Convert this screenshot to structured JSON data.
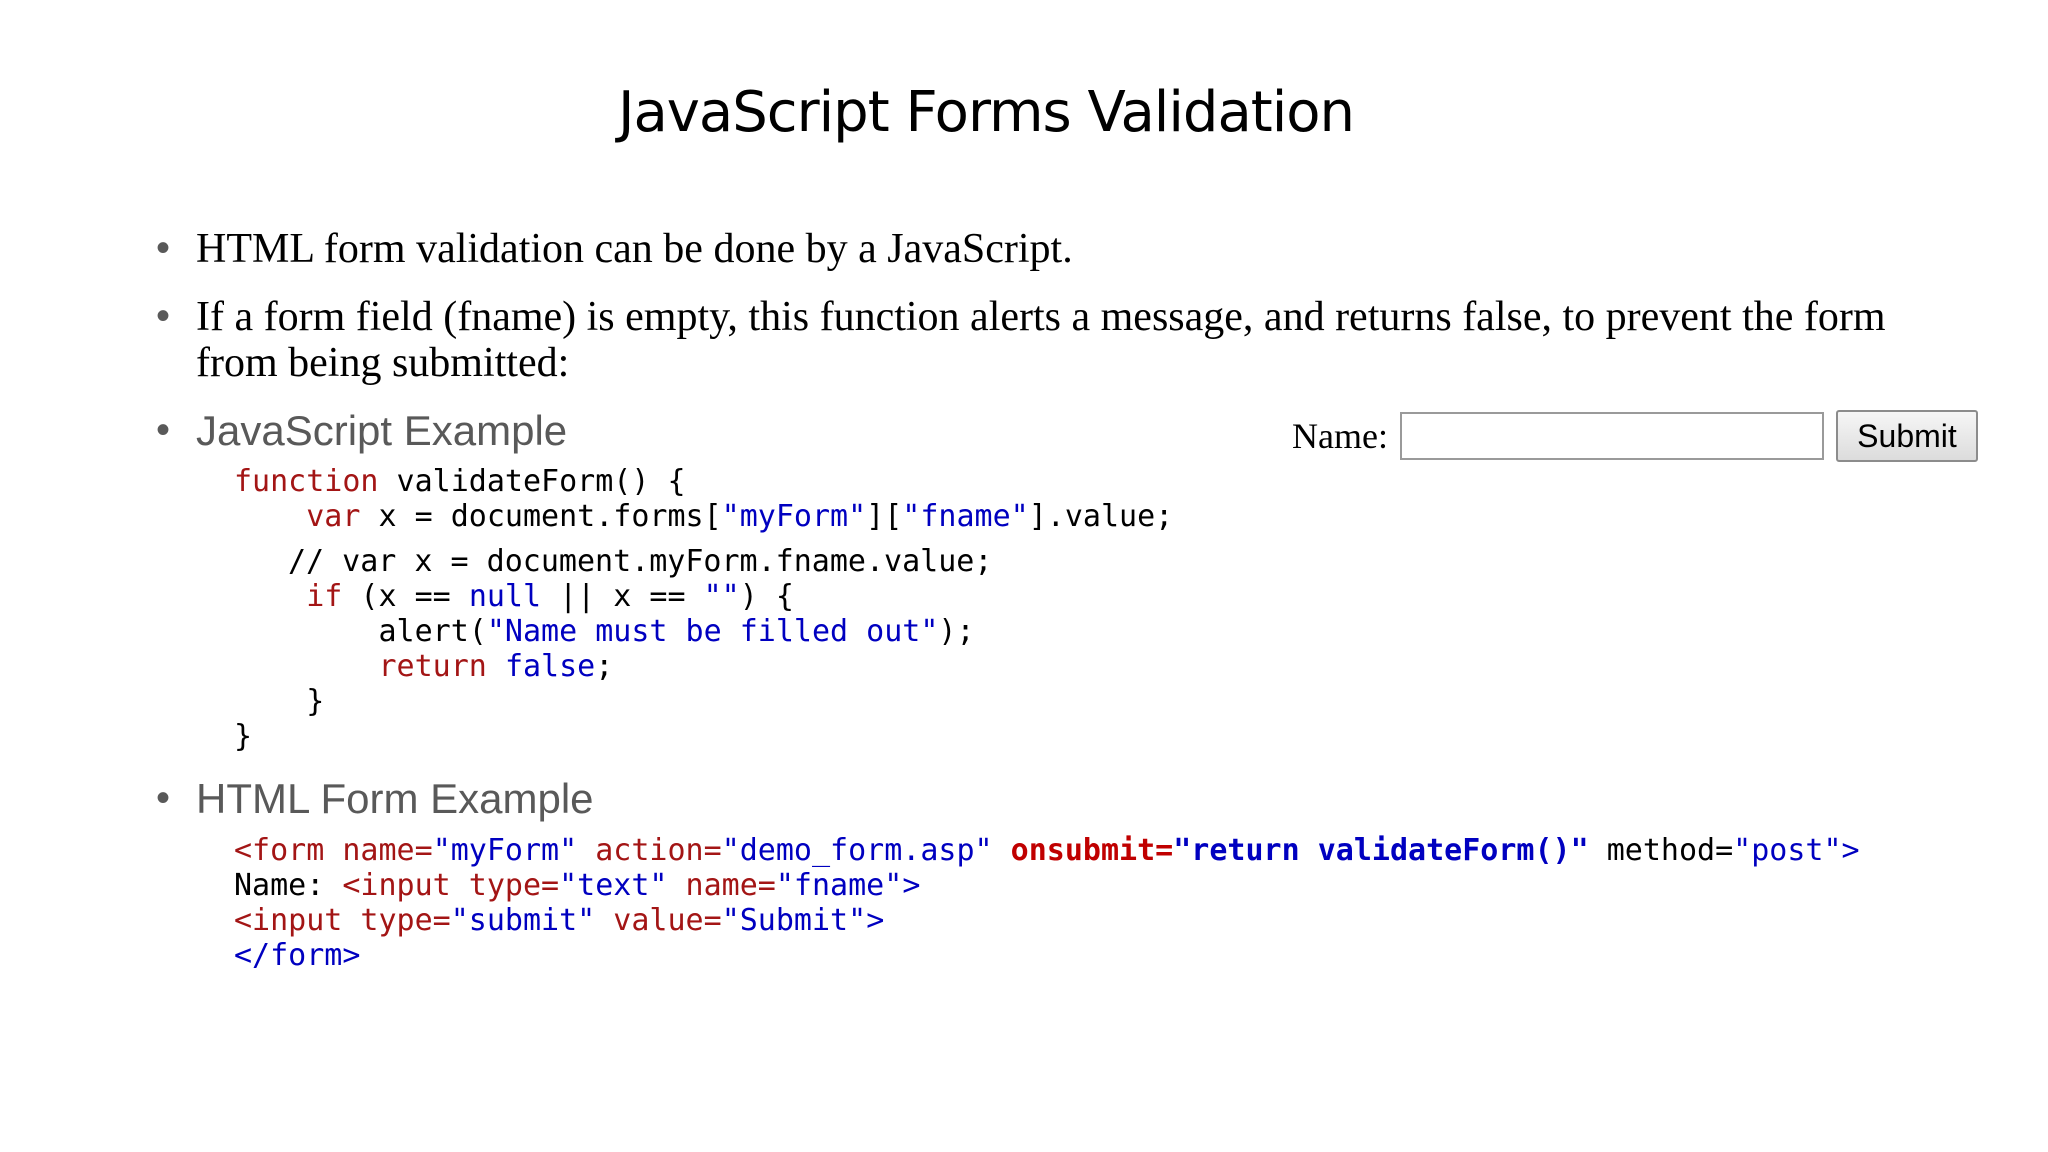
{
  "title": "JavaScript Forms Validation",
  "bullets": [
    {
      "text": "HTML form validation can be done by a JavaScript."
    },
    {
      "text": "If a form field (fname) is empty, this function alerts a message, and returns false, to prevent the form from being submitted:"
    },
    {
      "text": "JavaScript Example"
    },
    {
      "text": "HTML Form Example"
    }
  ],
  "js_code": {
    "l1_kw": "function",
    "l1_rest": " validateForm() {",
    "l2_kw": "var",
    "l2_rest": " x = document.forms[",
    "l2_s1": "\"myForm\"",
    "l2_mid": "][",
    "l2_s2": "\"fname\"",
    "l2_end": "].value;",
    "l3": "// var x = document.myForm.fname.value;",
    "l4_kw": "if",
    "l4_a": " (x == ",
    "l4_null": "null",
    "l4_b": " || x == ",
    "l4_s": "\"\"",
    "l4_c": ") {",
    "l5_a": "alert(",
    "l5_s": "\"Name must be filled out\"",
    "l5_b": ");",
    "l6_kw": "return",
    "l6_false": "false",
    "l6_end": ";",
    "l7": "}",
    "l8": "}"
  },
  "html_code": {
    "l1_tag": "<form",
    "l1_a1": " name=",
    "l1_v1": "\"myForm\"",
    "l1_a2": " action=",
    "l1_v2": "\"demo_form.asp\"",
    "l1_a3": " onsubmit=",
    "l1_v3": "\"return validateForm()\"",
    "l1_a4": " method=",
    "l1_v4": "\"post\"",
    "l1_close": ">",
    "l2_label": "Name: ",
    "l2_tag": "<input",
    "l2_a1": " type=",
    "l2_v1": "\"text\"",
    "l2_a2": " name=",
    "l2_v2": "\"fname\"",
    "l2_close": ">",
    "l3_tag": "<input",
    "l3_a1": " type=",
    "l3_v1": "\"submit\"",
    "l3_a2": " value=",
    "l3_v2": "\"Submit\"",
    "l3_close": ">",
    "l4": "</form>"
  },
  "demo_form": {
    "label": "Name:",
    "input_value": "",
    "submit_label": "Submit"
  }
}
